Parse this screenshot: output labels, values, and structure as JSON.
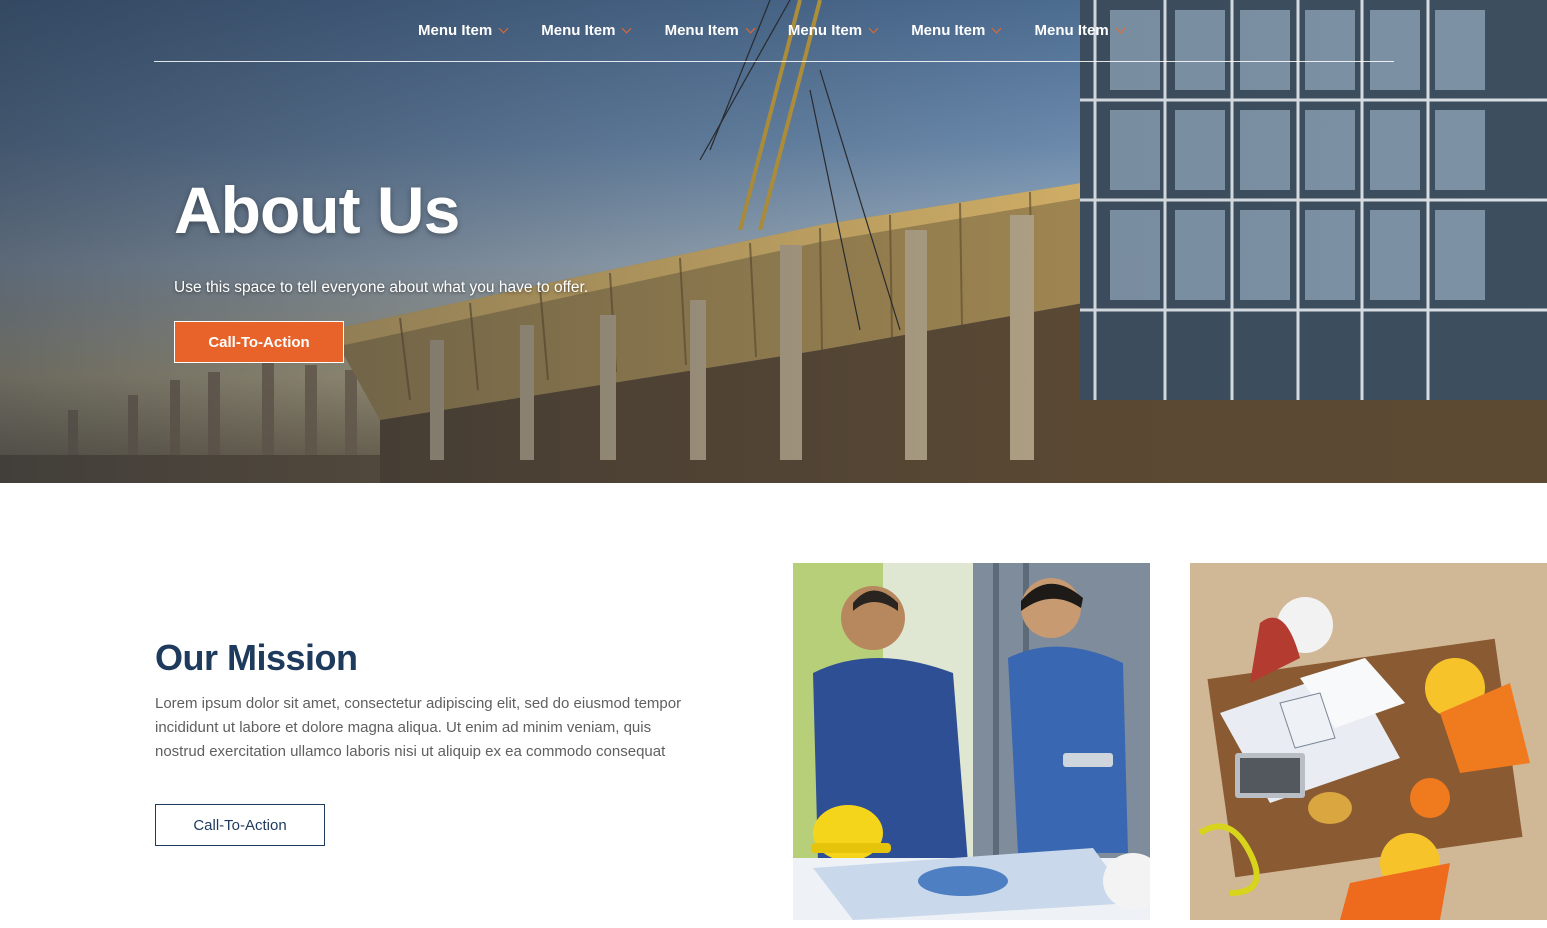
{
  "nav": {
    "items": [
      {
        "label": "Menu Item"
      },
      {
        "label": "Menu Item"
      },
      {
        "label": "Menu Item"
      },
      {
        "label": "Menu Item"
      },
      {
        "label": "Menu Item"
      },
      {
        "label": "Menu Item"
      }
    ]
  },
  "hero": {
    "title": "About Us",
    "subtitle": "Use this space to tell everyone about what you have to offer.",
    "cta_label": "Call-To-Action"
  },
  "mission": {
    "title": "Our Mission",
    "body_lines": [
      "Lorem ipsum dolor sit amet, consectetur adipiscing elit, sed do eiusmod tempor",
      "incididunt ut labore et dolore magna aliqua. Ut enim ad minim veniam, quis",
      "nostrud exercitation ullamco laboris nisi ut aliquip ex ea commodo consequat"
    ],
    "cta_label": "Call-To-Action"
  },
  "colors": {
    "accent": "#e8632a",
    "navy": "#1e3a5c",
    "body_text": "#5f5f5f"
  },
  "icons": {
    "nav_caret": "chevron-down-icon"
  }
}
